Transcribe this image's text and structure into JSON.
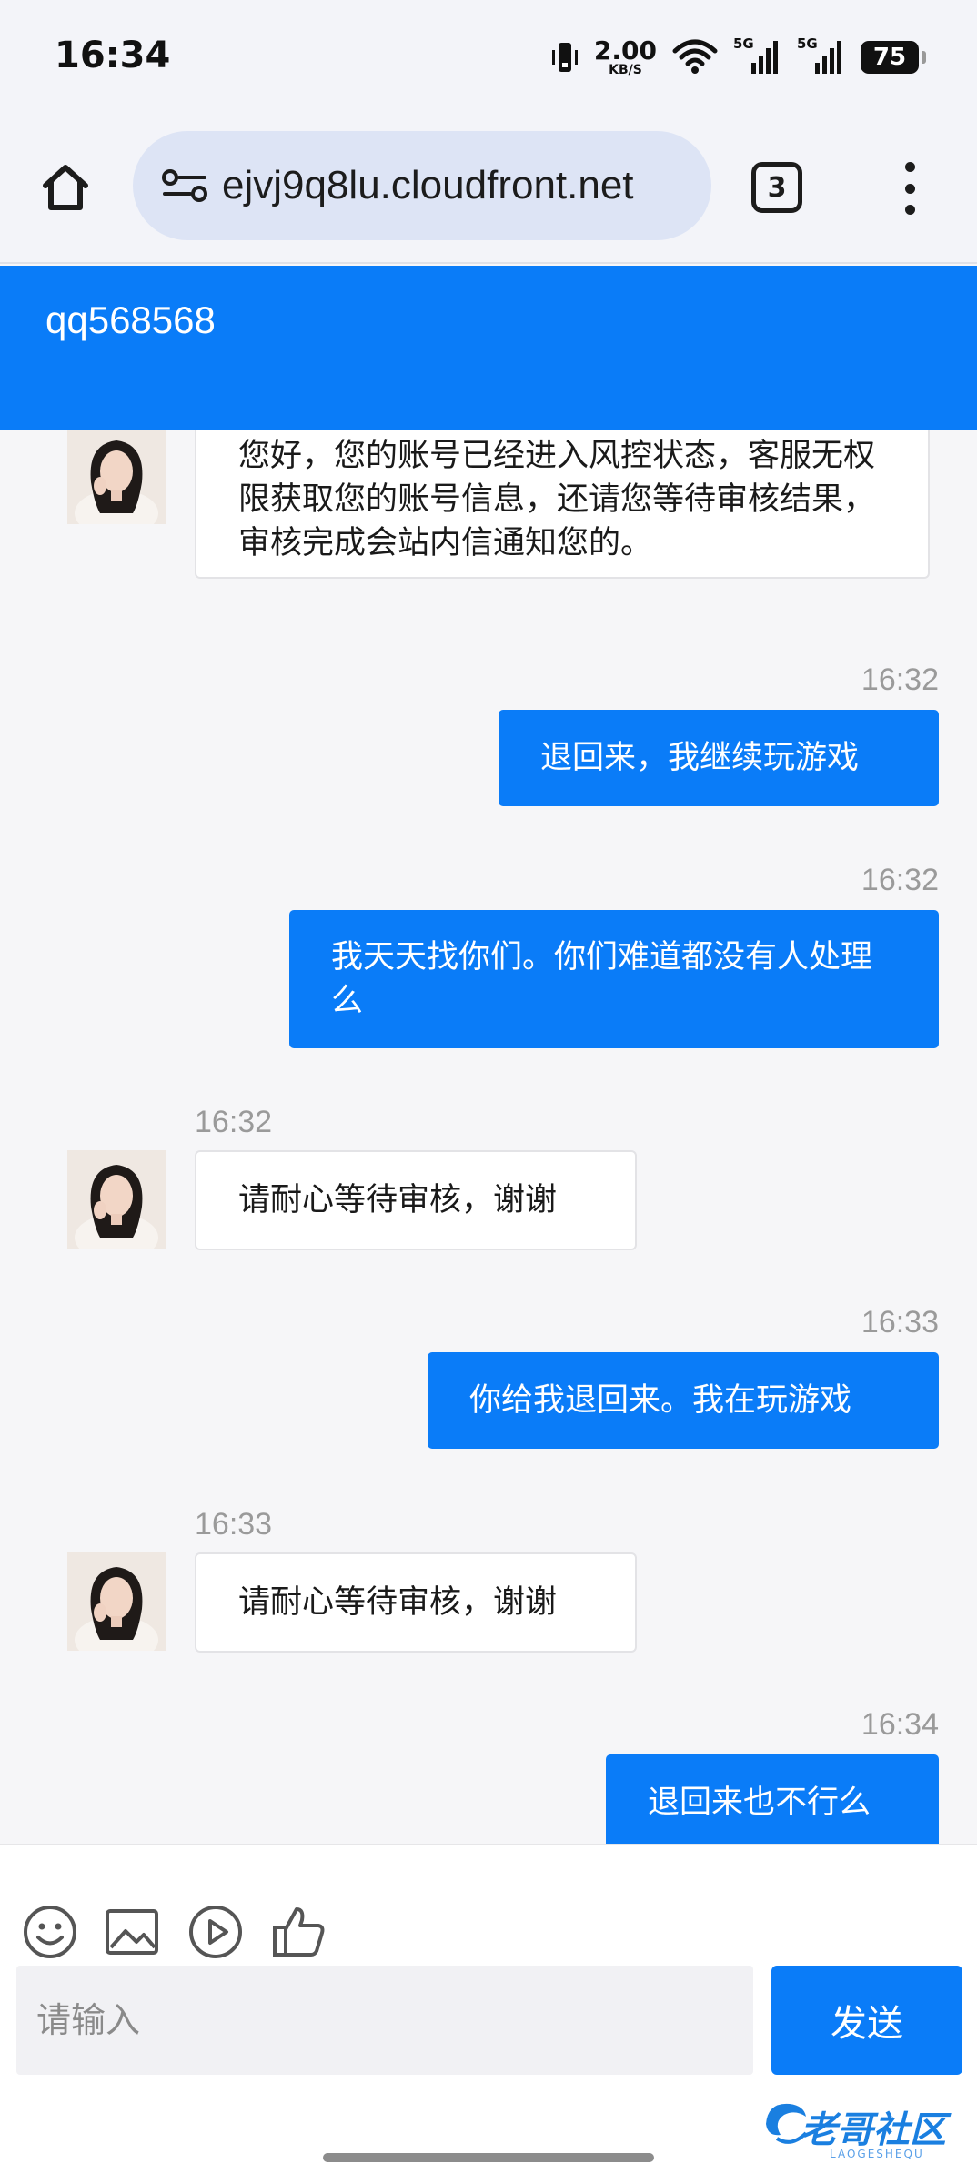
{
  "status_bar": {
    "time": "16:34",
    "speed_value": "2.00",
    "speed_unit": "KB/S",
    "signal_tag_1": "5G",
    "signal_tag_2": "5G",
    "battery": "75"
  },
  "browser": {
    "url": "ejvj9q8lu.cloudfront.net",
    "tab_count": "3"
  },
  "chat": {
    "title": "qq568568",
    "messages": [
      {
        "direction": "in",
        "time": "",
        "text": "您好，您的账号已经进入风控状态，客服无权限获取您的账号信息，还请您等待审核结果，审核完成会站内信通知您的。"
      },
      {
        "direction": "out",
        "time": "16:32",
        "text": "退回来，我继续玩游戏"
      },
      {
        "direction": "out",
        "time": "16:32",
        "text": "我天天找你们。你们难道都没有人处理么"
      },
      {
        "direction": "in",
        "time": "16:32",
        "text": "请耐心等待审核，谢谢"
      },
      {
        "direction": "out",
        "time": "16:33",
        "text": "你给我退回来。我在玩游戏"
      },
      {
        "direction": "in",
        "time": "16:33",
        "text": "请耐心等待审核，谢谢"
      },
      {
        "direction": "out",
        "time": "16:34",
        "text": "退回来也不行么"
      }
    ]
  },
  "composer": {
    "placeholder": "请输入",
    "send_label": "发送",
    "tools": [
      "emoji-icon",
      "image-icon",
      "video-icon",
      "thumbs-up-icon"
    ]
  },
  "watermark": {
    "text": "老哥社区",
    "sub": "LAOGESHEQU"
  },
  "colors": {
    "accent": "#0a7cf8",
    "background": "#f6f6f8",
    "bubble_in": "#ffffff"
  }
}
